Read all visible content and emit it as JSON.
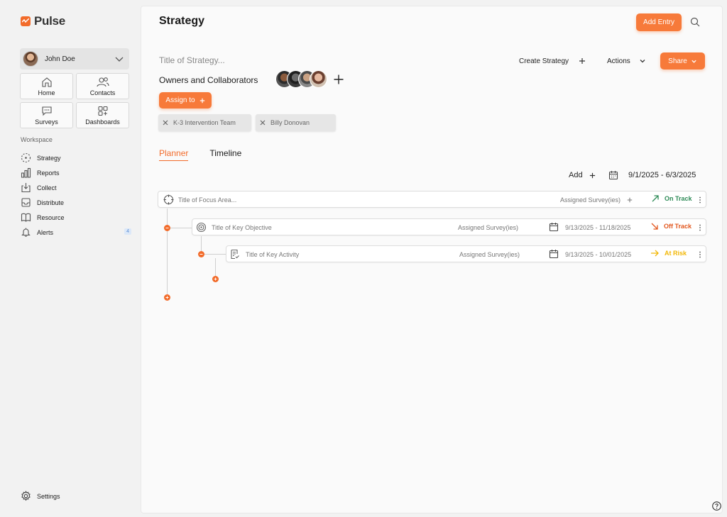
{
  "app": {
    "name": "Pulse"
  },
  "user": {
    "name": "John Doe"
  },
  "nav": [
    {
      "label": "Home",
      "icon": "home-icon"
    },
    {
      "label": "Contacts",
      "icon": "contacts-icon"
    },
    {
      "label": "Surveys",
      "icon": "surveys-icon"
    },
    {
      "label": "Dashboards",
      "icon": "dashboards-icon"
    }
  ],
  "workspace": {
    "label": "Workspace",
    "items": [
      {
        "label": "Strategy",
        "icon": "strategy-icon"
      },
      {
        "label": "Reports",
        "icon": "reports-icon"
      },
      {
        "label": "Collect",
        "icon": "collect-icon"
      },
      {
        "label": "Distribute",
        "icon": "distribute-icon"
      },
      {
        "label": "Resource",
        "icon": "resource-icon"
      },
      {
        "label": "Alerts",
        "icon": "alerts-icon",
        "badge": "4"
      }
    ]
  },
  "settings": {
    "label": "Settings"
  },
  "header": {
    "title": "Strategy",
    "add_entry_label": "Add Entry"
  },
  "strategy": {
    "title_placeholder": "Title of Strategy...",
    "create_label": "Create Strategy",
    "actions_label": "Actions",
    "share_label": "Share",
    "owners_label": "Owners and Collaborators",
    "assign_label": "Assign to",
    "assignees": [
      "K-3 Intervention Team",
      "Billy Donovan"
    ]
  },
  "tabs": [
    {
      "label": "Planner",
      "active": true
    },
    {
      "label": "Timeline",
      "active": false
    }
  ],
  "planner": {
    "add_label": "Add",
    "date_range": "9/1/2025 - 6/3/2025",
    "focus_area": {
      "title": "Title of Focus Area...",
      "surveys_label": "Assigned Survey(ies)",
      "status": "On Track",
      "status_color": "#2e8b57"
    },
    "objective": {
      "title": "Title of Key Objective",
      "surveys_label": "Assigned Survey(ies)",
      "dates": "9/13/2025 - 11/18/2025",
      "status": "Off Track",
      "status_color": "#e2571e"
    },
    "activity": {
      "title": "Title of Key Activity",
      "surveys_label": "Assigned Survey(ies)",
      "dates": "9/13/2025 - 10/01/2025",
      "status": "At Risk",
      "status_color": "#f2b705"
    }
  },
  "colors": {
    "accent": "#f77a3a",
    "brand": "#f26b2a"
  }
}
